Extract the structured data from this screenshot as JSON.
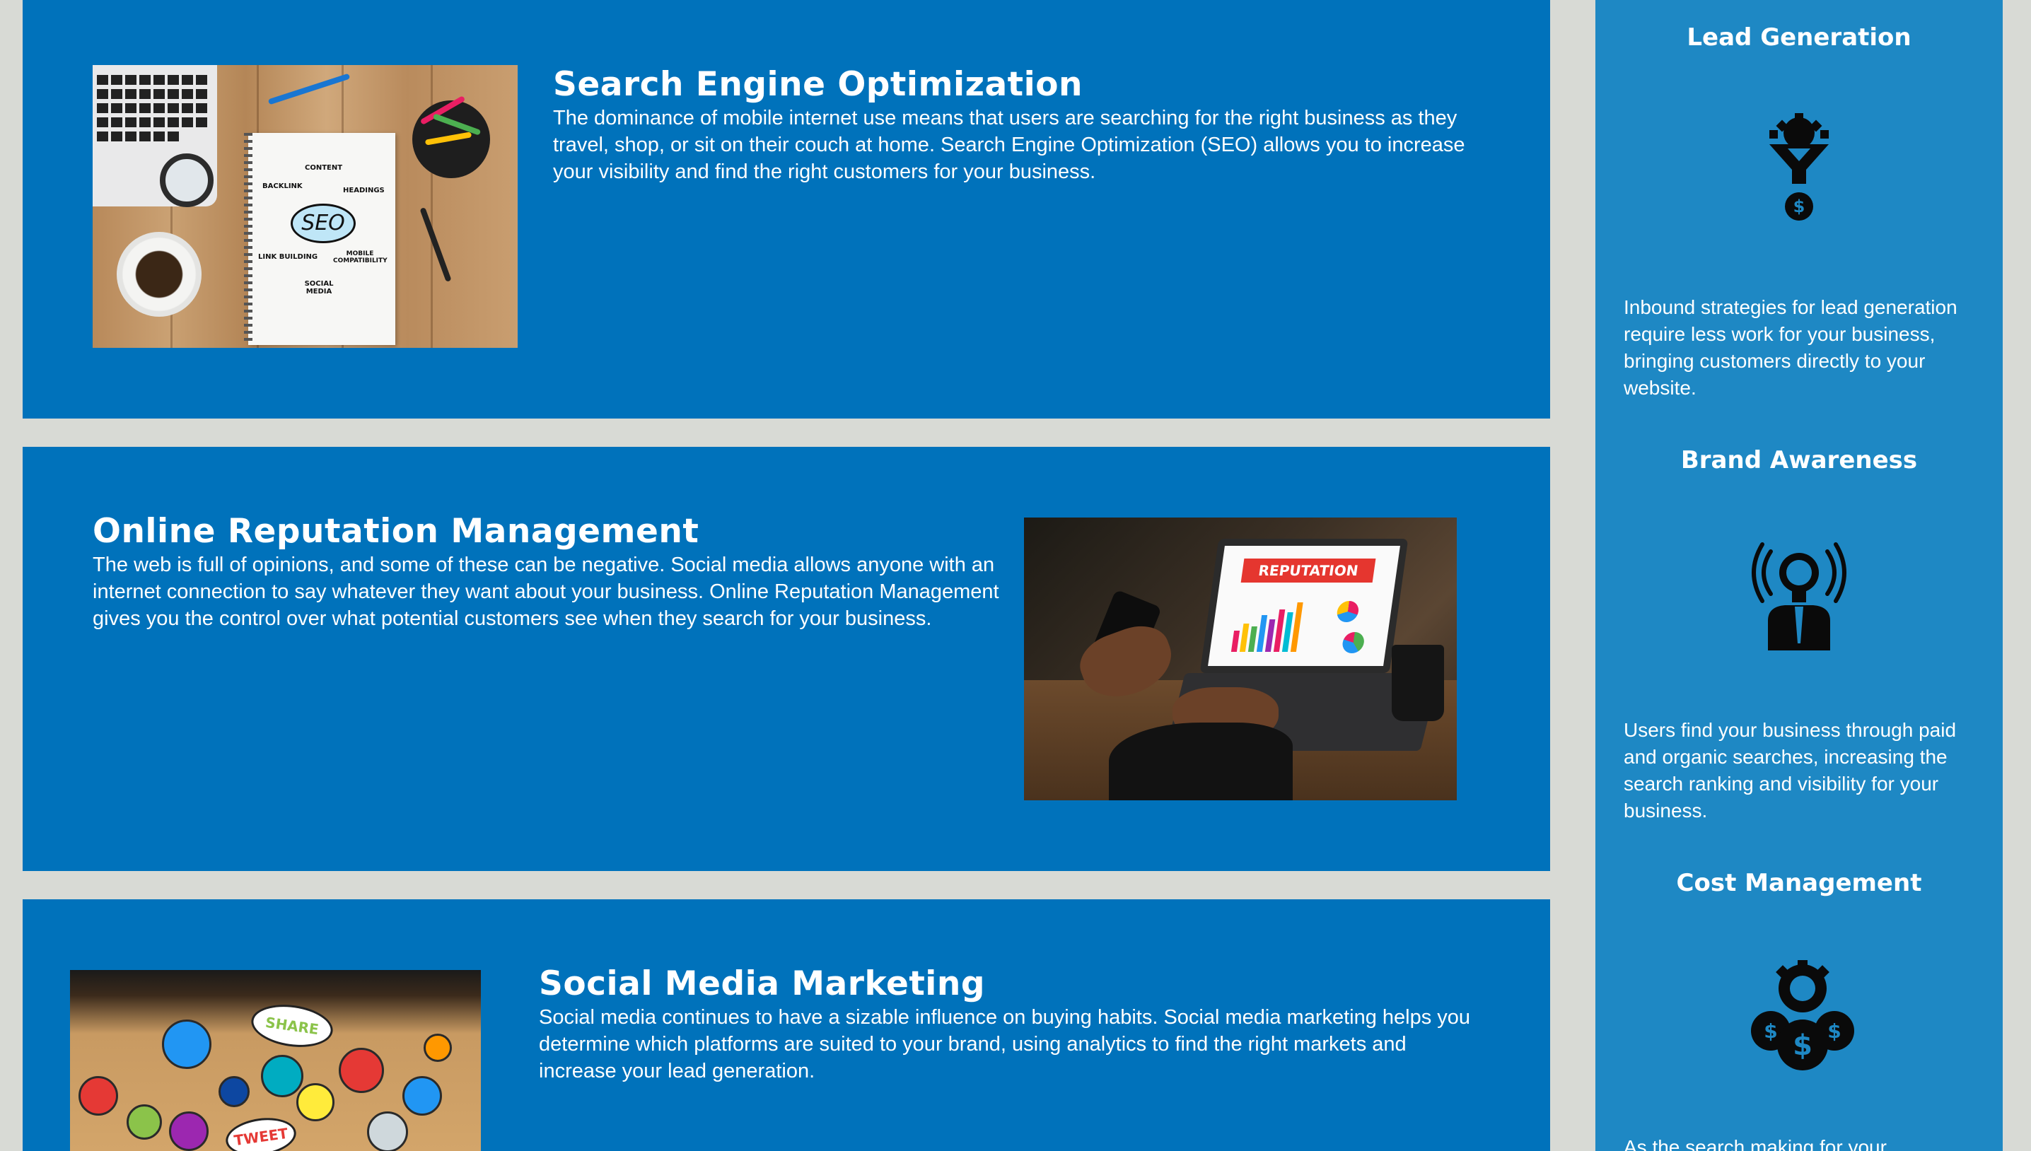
{
  "services": [
    {
      "id": "seo",
      "title": "Search Engine Optimization",
      "text": "The dominance of mobile internet use means that users are searching for the right business as they travel, shop, or sit on their couch at home. Search Engine Optimization (SEO) allows you to increase your visibility and find the right customers for your business.",
      "image_words": [
        "CONTENT",
        "BACKLINK",
        "HEADINGS",
        "SEO",
        "LINK BUILDING",
        "MOBILE COMPATIBILITY",
        "SOCIAL MEDIA"
      ]
    },
    {
      "id": "orm",
      "title": "Online Reputation Management",
      "text": "The web is full of opinions, and some of these can be negative. Social media allows anyone with an internet connection to say whatever they want about your business. Online Reputation Management gives you the control over what potential customers see when they search for your business.",
      "image_words": [
        "REPUTATION"
      ]
    },
    {
      "id": "smm",
      "title": "Social Media Marketing",
      "text": "Social media continues to have a sizable influence on buying habits. Social media marketing helps you determine which platforms are suited to your brand, using analytics to find the right markets and increase your lead generation.",
      "image_words": [
        "SHARE",
        "TWEET"
      ]
    }
  ],
  "sidebar": [
    {
      "title": "Lead Generation",
      "icon": "gear-funnel-dollar-icon",
      "text": "Inbound strategies for lead generation require less work for your business, bringing customers directly to your website."
    },
    {
      "title": "Brand Awareness",
      "icon": "lightbulb-person-broadcast-icon",
      "text": "Users find your business through paid and organic searches, increasing the search ranking and visibility for your business."
    },
    {
      "title": "Cost Management",
      "icon": "gears-dollar-coins-icon",
      "text": "As the search making for your"
    }
  ],
  "colors": {
    "page_background": "#d8dad5",
    "card_background": "#0072bb",
    "sidebar_background": "#1e88c4",
    "text": "#ffffff"
  }
}
